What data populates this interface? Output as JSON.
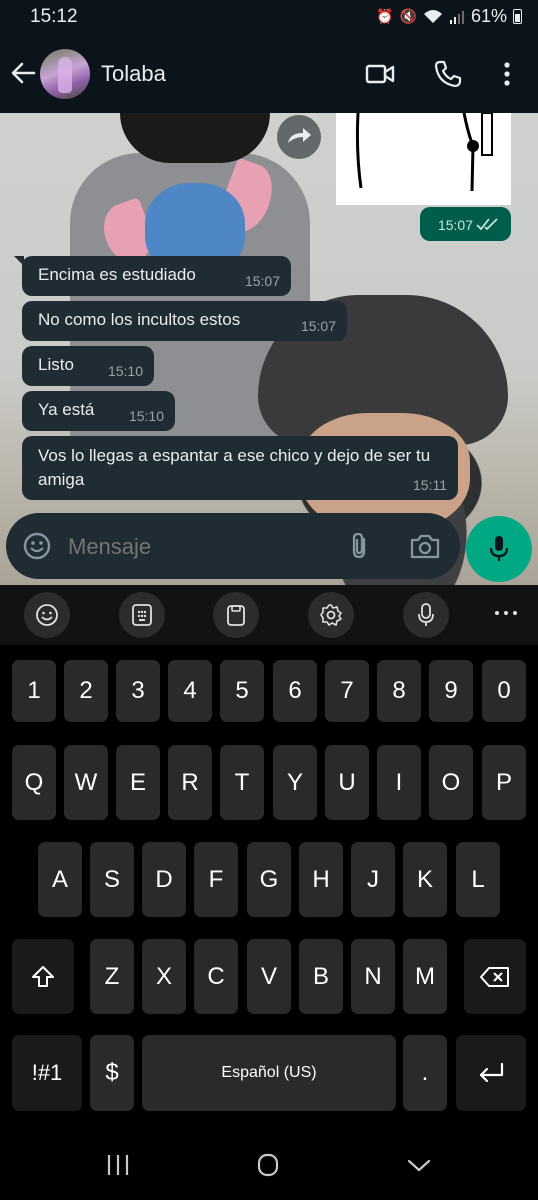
{
  "status_bar": {
    "time": "15:12",
    "battery": "61%"
  },
  "header": {
    "contact_name": "Tolaba"
  },
  "messages": [
    {
      "text": "Encima es estudiado",
      "time": "15:07"
    },
    {
      "text": "No como los incultos estos",
      "time": "15:07"
    },
    {
      "text": "Listo",
      "time": "15:10"
    },
    {
      "text": "Ya está",
      "time": "15:10"
    },
    {
      "text": "Vos lo llegas a espantar a ese chico y dejo de ser tu amiga",
      "time": "15:11"
    }
  ],
  "sent_image": {
    "time": "15:07"
  },
  "input": {
    "placeholder": "Mensaje"
  },
  "keyboard": {
    "numbers": [
      "1",
      "2",
      "3",
      "4",
      "5",
      "6",
      "7",
      "8",
      "9",
      "0"
    ],
    "row1": [
      "Q",
      "W",
      "E",
      "R",
      "T",
      "Y",
      "U",
      "I",
      "O",
      "P"
    ],
    "row2": [
      "A",
      "S",
      "D",
      "F",
      "G",
      "H",
      "J",
      "K",
      "L"
    ],
    "row3": [
      "Z",
      "X",
      "C",
      "V",
      "B",
      "N",
      "M"
    ],
    "symbols_label": "!#1",
    "currency_label": "$",
    "space_label": "Español (US)",
    "period_label": "."
  },
  "colors": {
    "accent": "#00a884",
    "bubble_in": "#1f2c34",
    "bubble_out": "#005c4b",
    "header": "#0b141a"
  }
}
